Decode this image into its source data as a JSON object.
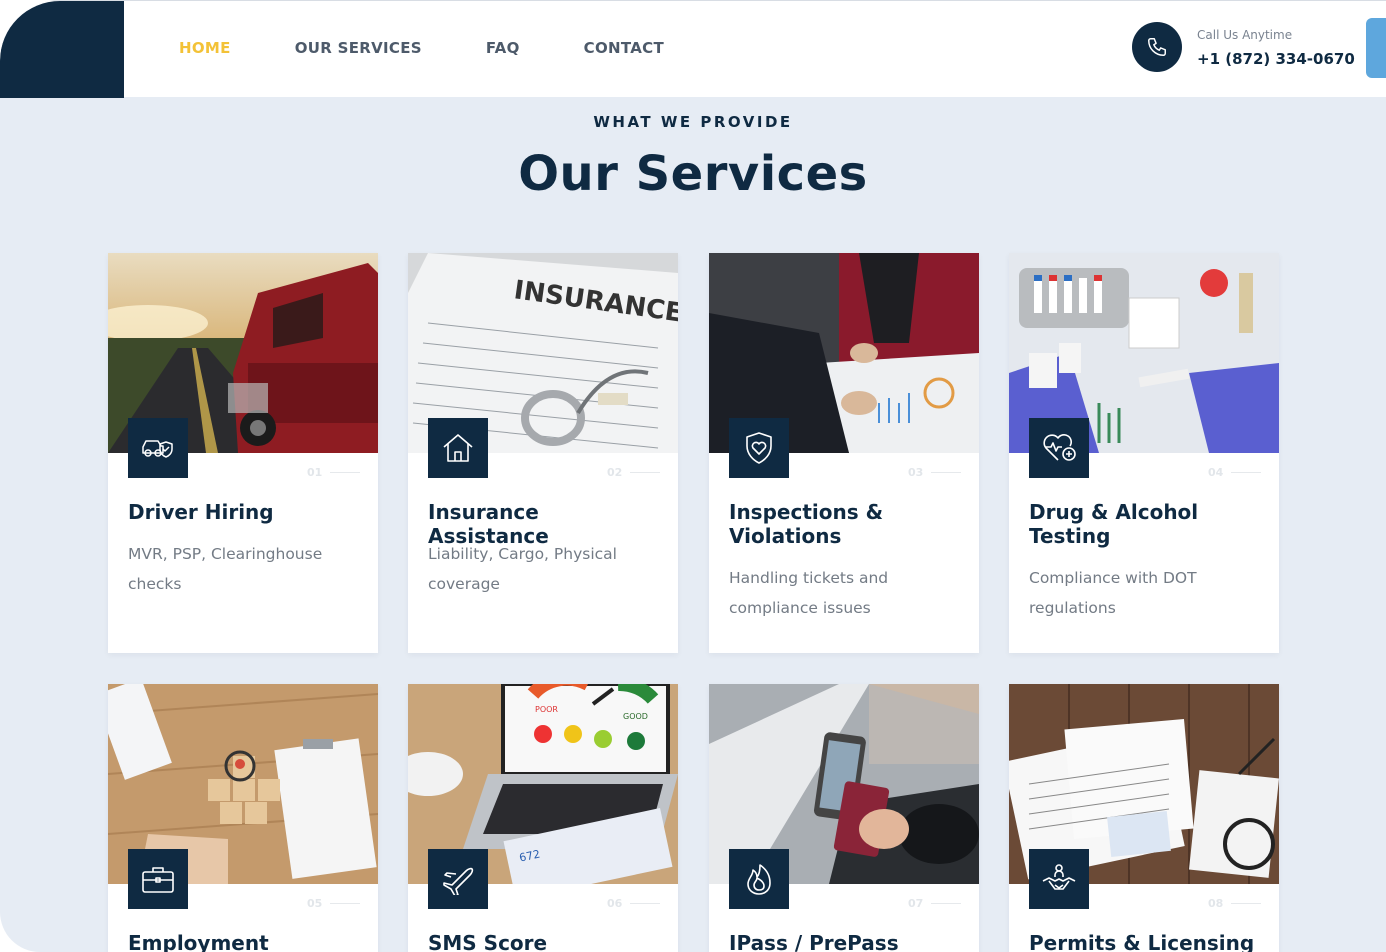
{
  "header": {
    "nav": [
      {
        "label": "HOME",
        "active": true
      },
      {
        "label": "OUR SERVICES",
        "active": false
      },
      {
        "label": "FAQ",
        "active": false
      },
      {
        "label": "CONTACT",
        "active": false
      }
    ],
    "phone_caption": "Call Us Anytime",
    "phone_number": "+1 (872) 334-0670",
    "phone_icon": "phone-icon"
  },
  "section": {
    "kicker": "WHAT WE PROVIDE",
    "title": "Our Services"
  },
  "cards": [
    {
      "num": "01",
      "title": "Driver Hiring",
      "desc": "MVR, PSP, Clearinghouse checks",
      "icon": "car-shield-icon"
    },
    {
      "num": "02",
      "title": "Insurance Assistance",
      "desc": "Liability, Cargo, Physical coverage",
      "icon": "house-icon"
    },
    {
      "num": "03",
      "title": "Inspections & Violations",
      "desc": "Handling tickets and compliance issues",
      "icon": "shield-heart-icon"
    },
    {
      "num": "04",
      "title": "Drug & Alcohol Testing",
      "desc": "Compliance with DOT regulations",
      "icon": "heart-pulse-icon"
    },
    {
      "num": "05",
      "title": "Employment",
      "desc": "",
      "icon": "briefcase-icon"
    },
    {
      "num": "06",
      "title": "SMS Score",
      "desc": "",
      "icon": "airplane-icon"
    },
    {
      "num": "07",
      "title": "IPass / PrePass",
      "desc": "",
      "icon": "flame-icon"
    },
    {
      "num": "08",
      "title": "Permits & Licensing",
      "desc": "",
      "icon": "handshake-icon"
    }
  ],
  "colors": {
    "navy": "#0f2a42",
    "accent": "#f3c237",
    "background": "#e6ecf4",
    "scroll_tab": "#5ea7dd"
  }
}
